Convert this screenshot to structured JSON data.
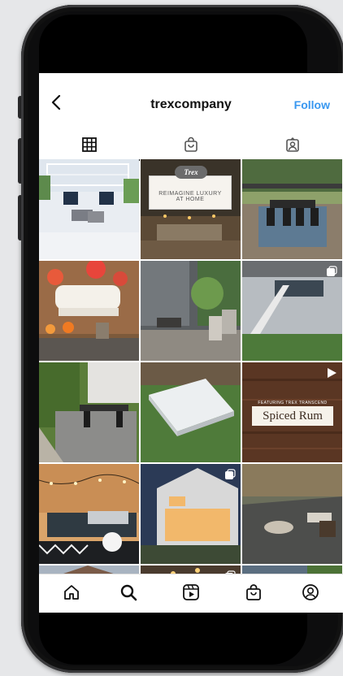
{
  "header": {
    "username": "trexcompany",
    "follow_label": "Follow"
  },
  "tabs": [
    {
      "name": "grid-icon",
      "active": true
    },
    {
      "name": "shop-bag-icon",
      "active": false
    },
    {
      "name": "tagged-icon",
      "active": false
    }
  ],
  "posts": [
    {
      "type": "photo",
      "overlay": null
    },
    {
      "type": "photo",
      "overlay": {
        "logo": "Trex",
        "text1": "REIMAGINE LUXURY",
        "text2": "AT HOME"
      }
    },
    {
      "type": "photo",
      "overlay": null
    },
    {
      "type": "photo",
      "overlay": null
    },
    {
      "type": "photo",
      "overlay": null
    },
    {
      "type": "carousel",
      "overlay": null
    },
    {
      "type": "photo",
      "overlay": null
    },
    {
      "type": "photo",
      "overlay": null
    },
    {
      "type": "video",
      "overlay": {
        "small": "FEATURING TREX TRANSCEND",
        "title": "Spiced Rum"
      }
    },
    {
      "type": "photo",
      "overlay": null
    },
    {
      "type": "carousel",
      "overlay": null
    },
    {
      "type": "photo",
      "overlay": null
    },
    {
      "type": "photo",
      "overlay": null
    },
    {
      "type": "carousel",
      "overlay": null
    },
    {
      "type": "photo",
      "overlay": null
    }
  ],
  "bottom_nav": [
    {
      "name": "home-icon"
    },
    {
      "name": "search-icon"
    },
    {
      "name": "reels-icon"
    },
    {
      "name": "shop-icon"
    },
    {
      "name": "profile-icon"
    }
  ],
  "colors": {
    "link_blue": "#3897f0",
    "frame": "#0d0d0e",
    "background": "#e6e7e9"
  }
}
